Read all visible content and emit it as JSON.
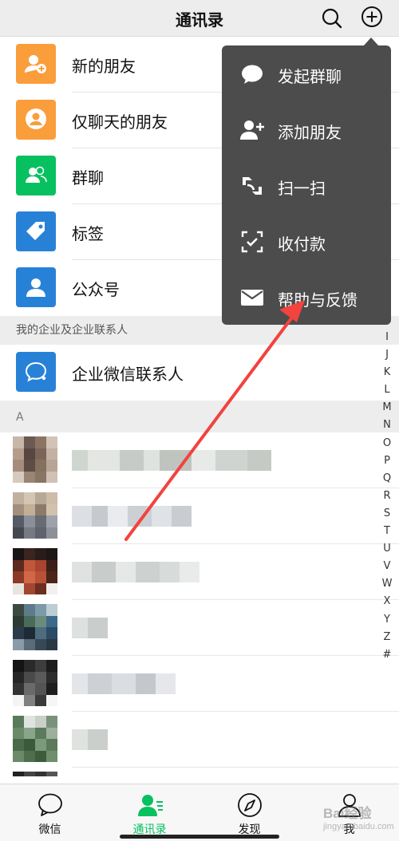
{
  "header": {
    "title": "通讯录"
  },
  "function_rows": [
    {
      "label": "新的朋友",
      "icon": "add-friend-icon",
      "color": "#fa9d3b"
    },
    {
      "label": "仅聊天的朋友",
      "icon": "chat-only-friend-icon",
      "color": "#fa9d3b"
    },
    {
      "label": "群聊",
      "icon": "group-chat-icon",
      "color": "#07c160"
    },
    {
      "label": "标签",
      "icon": "tag-icon",
      "color": "#2782d7"
    },
    {
      "label": "公众号",
      "icon": "official-account-icon",
      "color": "#2782d7"
    }
  ],
  "enterprise_section": {
    "title": "我的企业及企业联系人",
    "row": {
      "label": "企业微信联系人",
      "icon": "wecom-icon",
      "color": "#2782d7"
    }
  },
  "contacts_section": {
    "letter": "A"
  },
  "popup_menu": {
    "items": [
      {
        "label": "发起群聊",
        "icon": "chat-bubble-icon"
      },
      {
        "label": "添加朋友",
        "icon": "add-friend-icon"
      },
      {
        "label": "扫一扫",
        "icon": "scan-icon"
      },
      {
        "label": "收付款",
        "icon": "payment-icon"
      },
      {
        "label": "帮助与反馈",
        "icon": "mail-icon"
      }
    ]
  },
  "alpha_index": [
    "I",
    "J",
    "K",
    "L",
    "M",
    "N",
    "O",
    "P",
    "Q",
    "R",
    "S",
    "T",
    "U",
    "V",
    "W",
    "X",
    "Y",
    "Z",
    "#"
  ],
  "tabbar": {
    "tabs": [
      {
        "label": "微信",
        "icon": "chat-icon",
        "active": false
      },
      {
        "label": "通讯录",
        "icon": "contacts-icon",
        "active": true
      },
      {
        "label": "发现",
        "icon": "compass-icon",
        "active": false
      },
      {
        "label": "我",
        "icon": "me-icon",
        "active": false
      }
    ],
    "active_color": "#07c160"
  },
  "watermark": {
    "text": "Bai经验",
    "sub": "jingyan.baidu.com"
  },
  "annotation_arrow_color": "#f2433f"
}
